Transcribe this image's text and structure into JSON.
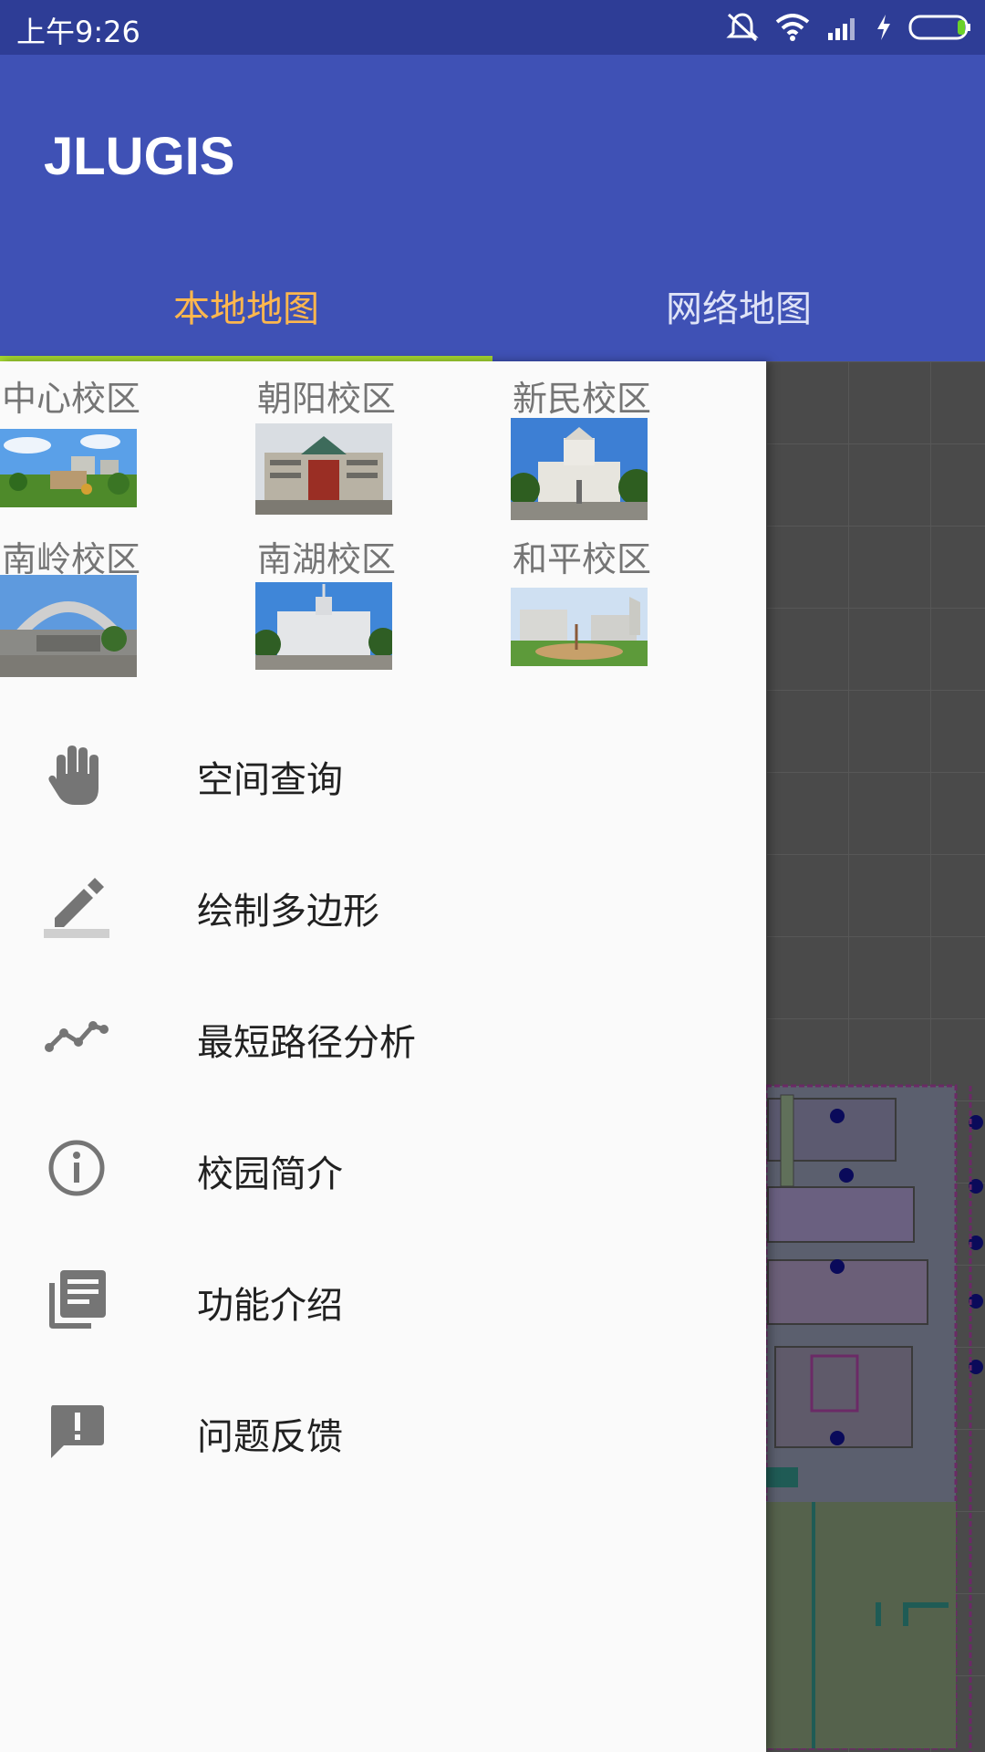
{
  "status_bar": {
    "time": "上午9:26",
    "icons": [
      "mute-icon",
      "wifi-icon",
      "signal-icon",
      "charging-icon",
      "battery-icon"
    ]
  },
  "app_bar": {
    "title": "JLUGIS",
    "tabs": [
      {
        "label": "本地地图",
        "active": true
      },
      {
        "label": "网络地图",
        "active": false
      }
    ]
  },
  "drawer": {
    "campuses": [
      {
        "label": "中心校区"
      },
      {
        "label": "朝阳校区"
      },
      {
        "label": "新民校区"
      },
      {
        "label": "南岭校区"
      },
      {
        "label": "南湖校区"
      },
      {
        "label": "和平校区"
      }
    ],
    "menu": [
      {
        "label": "空间查询",
        "icon": "hand-icon"
      },
      {
        "label": "绘制多边形",
        "icon": "pencil-icon"
      },
      {
        "label": "最短路径分析",
        "icon": "polyline-icon"
      },
      {
        "label": "校园简介",
        "icon": "info-icon"
      },
      {
        "label": "功能介绍",
        "icon": "library-books-icon"
      },
      {
        "label": "问题反馈",
        "icon": "feedback-icon"
      }
    ]
  },
  "colors": {
    "status_bar": "#2e3d96",
    "app_bar": "#3f51b5",
    "tab_active": "#ffb74d",
    "tab_indicator": "#a3d630",
    "drawer_bg": "#fafafa"
  }
}
